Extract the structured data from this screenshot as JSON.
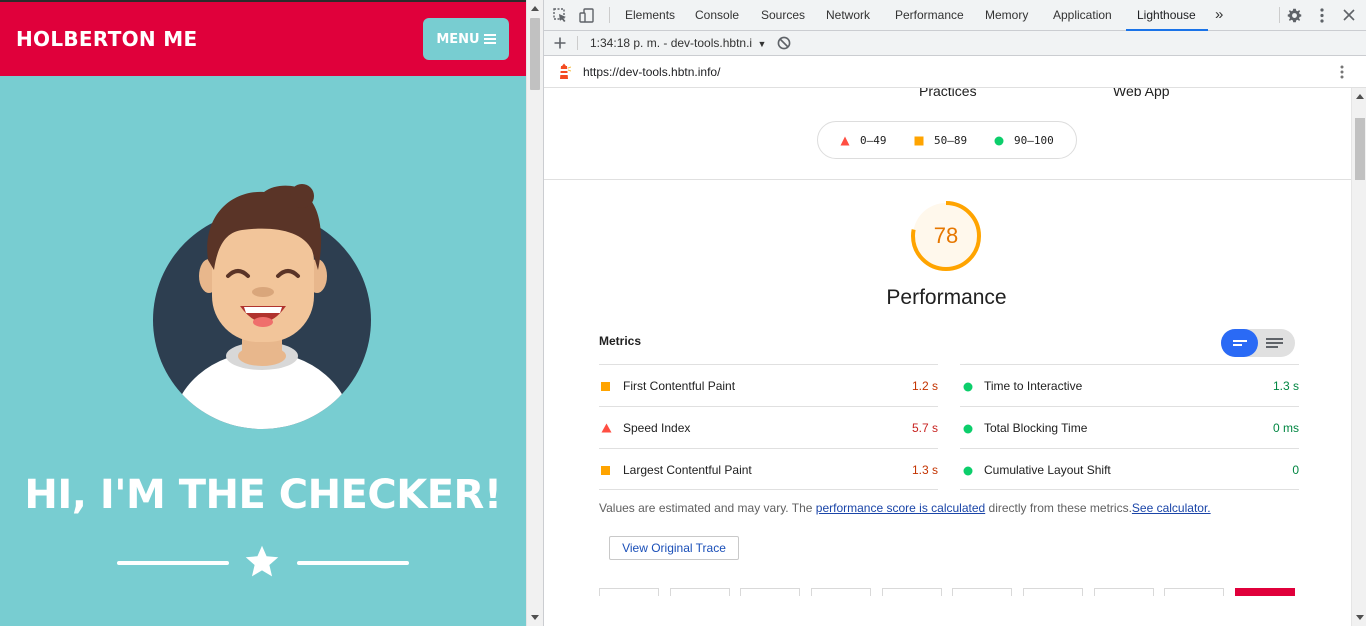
{
  "page": {
    "brand": "HOLBERTON ME",
    "menu_label": "MENU",
    "hero_title": "HI, I'M THE CHECKER!",
    "colors": {
      "navbar": "#e0003b",
      "background": "#78cdd1"
    }
  },
  "devtools": {
    "tabs": [
      {
        "label": "Elements"
      },
      {
        "label": "Console"
      },
      {
        "label": "Sources"
      },
      {
        "label": "Network"
      },
      {
        "label": "Performance"
      },
      {
        "label": "Memory"
      },
      {
        "label": "Application"
      },
      {
        "label": "Lighthouse"
      }
    ],
    "more_tabs": "»",
    "report_selector": "1:34:18 p. m. - dev-tools.hbtn.i",
    "report_url": "https://dev-tools.hbtn.info/"
  },
  "report": {
    "categories_partial": [
      "Practices",
      "Web App"
    ],
    "legend": [
      {
        "range": "0–49",
        "color": "#ff4e42"
      },
      {
        "range": "50–89",
        "color": "#ffa400"
      },
      {
        "range": "90–100",
        "color": "#0cce6b"
      }
    ],
    "score": 78,
    "category_title": "Performance",
    "metrics_title": "Metrics",
    "metrics": [
      {
        "name": "First Contentful Paint",
        "value": "1.2 s",
        "rating": "average"
      },
      {
        "name": "Time to Interactive",
        "value": "1.3 s",
        "rating": "pass"
      },
      {
        "name": "Speed Index",
        "value": "5.7 s",
        "rating": "fail"
      },
      {
        "name": "Total Blocking Time",
        "value": "0 ms",
        "rating": "pass"
      },
      {
        "name": "Largest Contentful Paint",
        "value": "1.3 s",
        "rating": "average"
      },
      {
        "name": "Cumulative Layout Shift",
        "value": "0",
        "rating": "pass"
      }
    ],
    "note_prefix": "Values are estimated and may vary. The ",
    "note_link": "performance score is calculated",
    "note_middle": " directly from these metrics.",
    "note_link2": "See calculator.",
    "trace_button": "View Original Trace"
  }
}
